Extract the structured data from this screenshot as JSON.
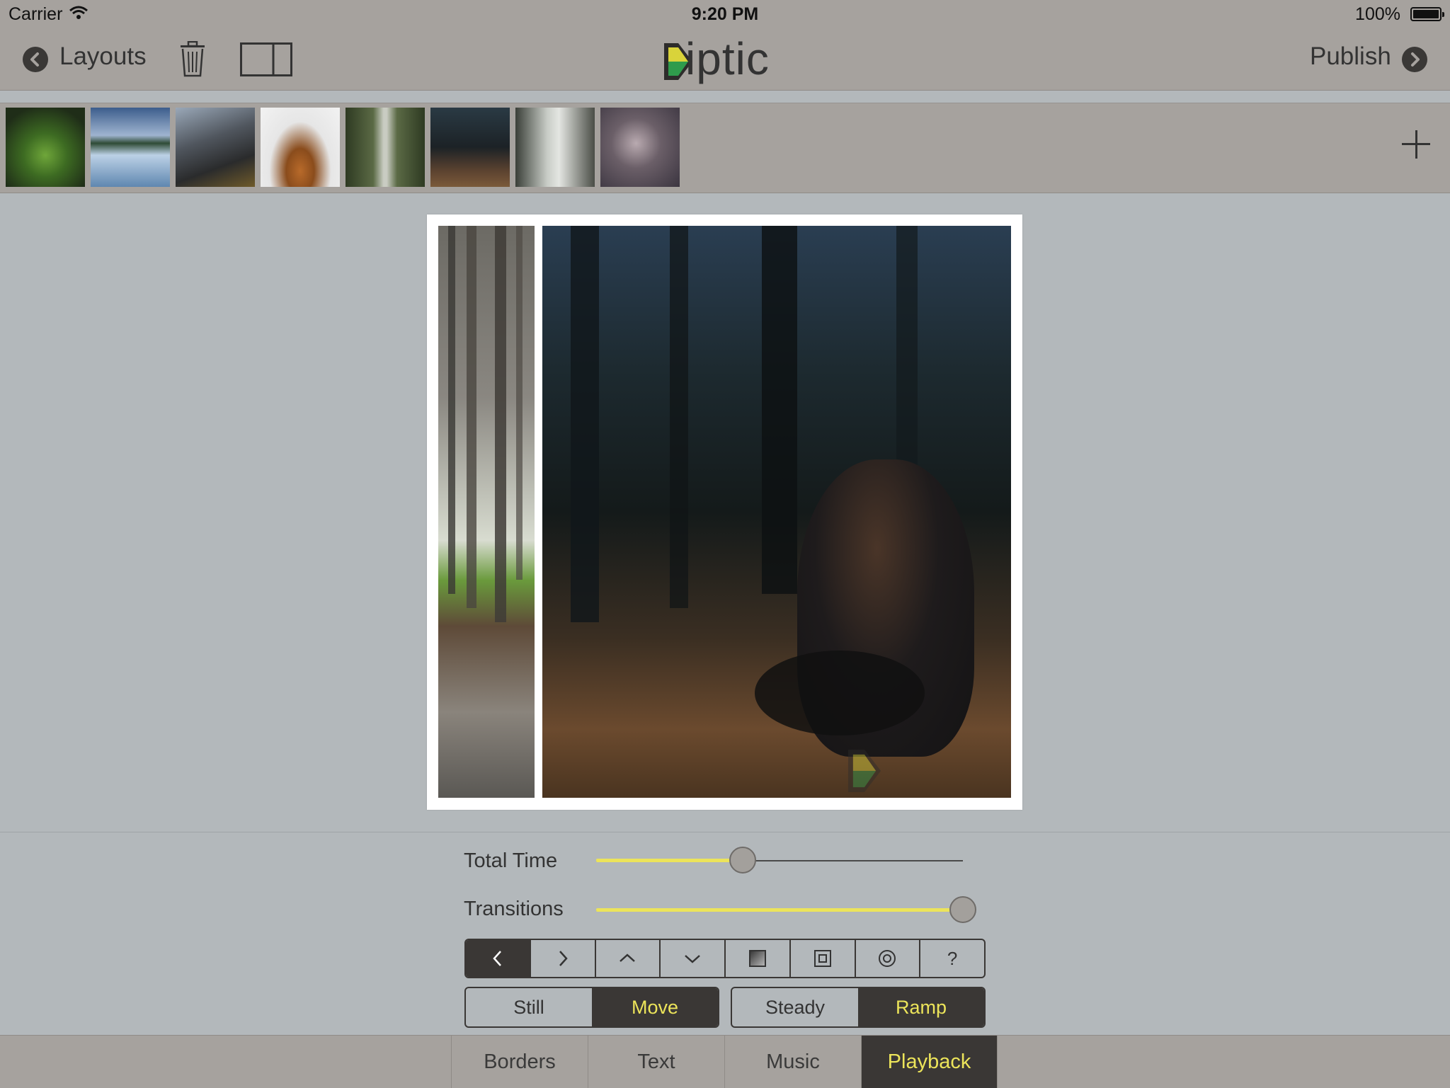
{
  "status_bar": {
    "carrier": "Carrier",
    "time": "9:20 PM",
    "battery": "100%"
  },
  "nav": {
    "back_label": "Layouts",
    "logo_text": "iptic",
    "publish_label": "Publish"
  },
  "thumbnails": [
    {
      "name": "plant"
    },
    {
      "name": "lake"
    },
    {
      "name": "mountains"
    },
    {
      "name": "hooded-person"
    },
    {
      "name": "road"
    },
    {
      "name": "forest-sitting"
    },
    {
      "name": "misty-forest"
    },
    {
      "name": "hand"
    }
  ],
  "controls": {
    "total_time_label": "Total Time",
    "total_time_value": 0.4,
    "transitions_label": "Transitions",
    "transitions_value": 1.0,
    "direction_buttons": [
      "‹",
      "›",
      "^",
      "⌄",
      "▣",
      "◫",
      "◎",
      "?"
    ],
    "motion_options": [
      "Still",
      "Move"
    ],
    "motion_selected": "Move",
    "speed_options": [
      "Steady",
      "Ramp"
    ],
    "speed_selected": "Ramp"
  },
  "tabs": [
    "Borders",
    "Text",
    "Music",
    "Playback"
  ],
  "active_tab": "Playback",
  "colors": {
    "accent_yellow": "#ece45a",
    "dark": "#3a3735",
    "bar": "#a6a29e",
    "background": "#b3b8bb"
  }
}
